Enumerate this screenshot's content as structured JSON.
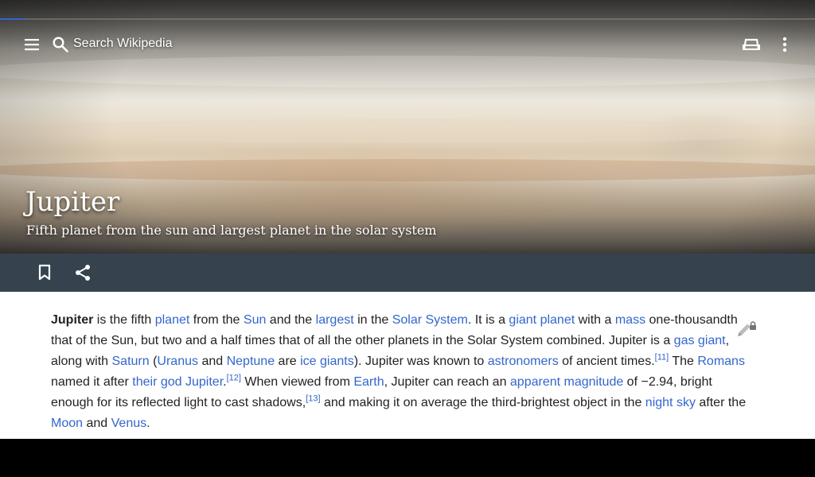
{
  "toolbar": {
    "search_placeholder": "Search Wikipedia",
    "menu_icon": "menu-icon",
    "search_icon": "search-icon",
    "reading_list_icon": "reading-list-icon",
    "overflow_icon": "more-vert-icon"
  },
  "progress": {
    "fraction": 0.03
  },
  "article": {
    "title": "Jupiter",
    "description": "Fifth planet from the sun and largest planet in the solar system",
    "p1": {
      "t0": "Jupiter",
      "t1": " is the fifth ",
      "l_planet": "planet",
      "t2": " from the ",
      "l_sun": "Sun",
      "t3": " and the ",
      "l_largest": "largest",
      "t4": " in the ",
      "l_solar_system": "Solar System",
      "t5": ". It is a ",
      "l_giant_planet": "giant planet",
      "t6": " with a ",
      "l_mass": "mass",
      "t7": " one-thousandth that of the Sun, but two and a half times that of all the other planets in the Solar System combined. Jupiter is a ",
      "l_gas_giant": "gas giant",
      "t8": ", along with ",
      "l_saturn": "Saturn",
      "t9": " (",
      "l_uranus": "Uranus",
      "t10": " and ",
      "l_neptune": "Neptune",
      "t11": " are ",
      "l_ice_giants": "ice giants",
      "t12": "). Jupiter was known to ",
      "l_astronomers": "astronomers",
      "t13": " of ancient times.",
      "ref11": "[11]",
      "t14": " The ",
      "l_romans": "Romans",
      "t15": " named it after ",
      "l_their_god_jupiter": "their god Jupiter",
      "t16": ".",
      "ref12": "[12]",
      "t17": " When viewed from ",
      "l_earth": "Earth",
      "t18": ", Jupiter can reach an ",
      "l_apparent_magnitude": "apparent magnitude",
      "t19": " of −2.94, bright enough for its reflected light to cast shadows,",
      "ref13": "[13]",
      "t20": " and making it on average the third-brightest object in the ",
      "l_night_sky": "night sky",
      "t21": " after the ",
      "l_moon": "Moon",
      "t22": " and ",
      "l_venus": "Venus",
      "t23": "."
    }
  },
  "actions": {
    "bookmark_icon": "bookmark-icon",
    "share_icon": "share-icon",
    "edit_icon": "edit-locked-icon"
  },
  "colors": {
    "link": "#3366cc",
    "action_bar": "#36434f",
    "progress": "#3366cc"
  }
}
